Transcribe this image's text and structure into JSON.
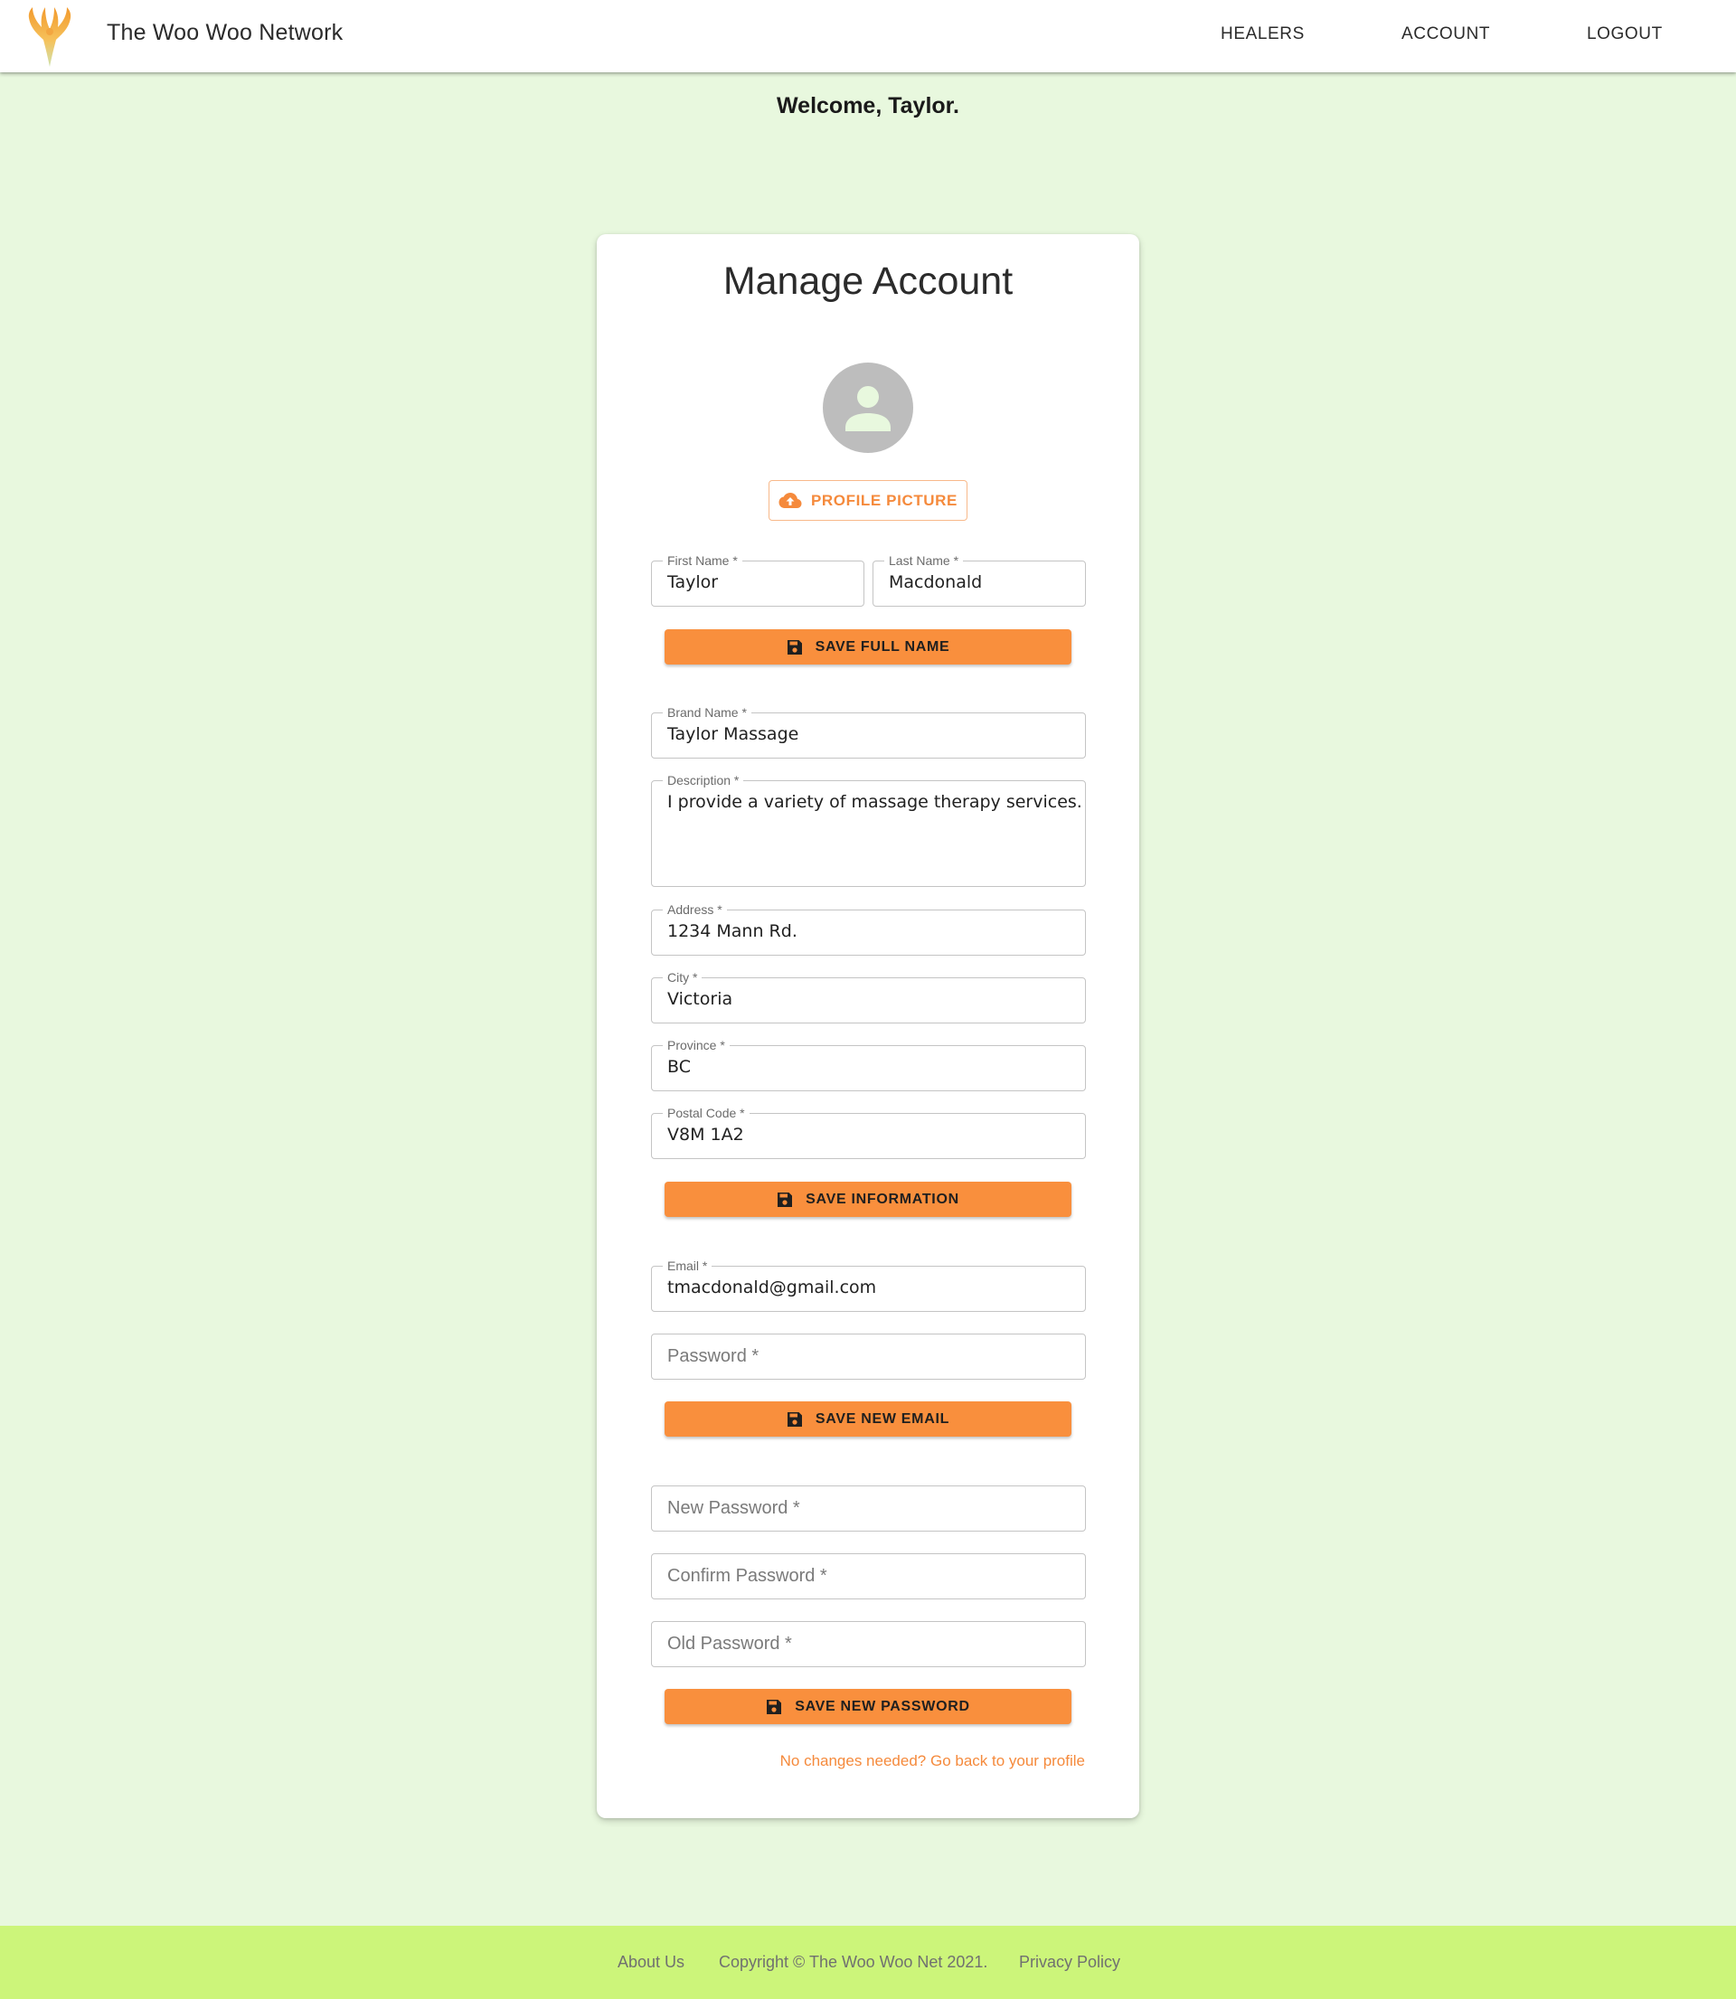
{
  "header": {
    "brand": "The Woo Woo Network",
    "nav": [
      "HEALERS",
      "ACCOUNT",
      "LOGOUT"
    ]
  },
  "welcome": "Welcome, Taylor.",
  "card": {
    "title": "Manage Account",
    "upload_label": "PROFILE PICTURE",
    "name_section": {
      "first_name_label": "First Name *",
      "first_name_value": "Taylor",
      "last_name_label": "Last Name *",
      "last_name_value": "Macdonald",
      "save_label": "SAVE FULL NAME"
    },
    "info_section": {
      "brand_label": "Brand Name *",
      "brand_value": "Taylor Massage",
      "description_label": "Description *",
      "description_value": "I provide a variety of massage therapy services.",
      "address_label": "Address *",
      "address_value": "1234 Mann Rd.",
      "city_label": "City *",
      "city_value": "Victoria",
      "province_label": "Province *",
      "province_value": "BC",
      "postal_label": "Postal Code *",
      "postal_value": "V8M 1A2",
      "save_label": "SAVE INFORMATION"
    },
    "email_section": {
      "email_label": "Email *",
      "email_value": "tmacdonald@gmail.com",
      "password_placeholder": "Password *",
      "save_label": "SAVE NEW EMAIL"
    },
    "password_section": {
      "new_placeholder": "New Password *",
      "confirm_placeholder": "Confirm Password *",
      "old_placeholder": "Old Password *",
      "save_label": "SAVE NEW PASSWORD"
    },
    "back_link": "No changes needed? Go back to your profile"
  },
  "footer": {
    "about": "About Us",
    "copyright": "Copyright © The Woo Woo Net 2021.",
    "privacy": "Privacy Policy"
  },
  "colors": {
    "accent": "#f98f3d",
    "background": "#e8f8de",
    "footer": "#ccf57a"
  },
  "icons": [
    "logo-flame-icon",
    "avatar-person-icon",
    "cloud-upload-icon",
    "save-floppy-icon"
  ]
}
